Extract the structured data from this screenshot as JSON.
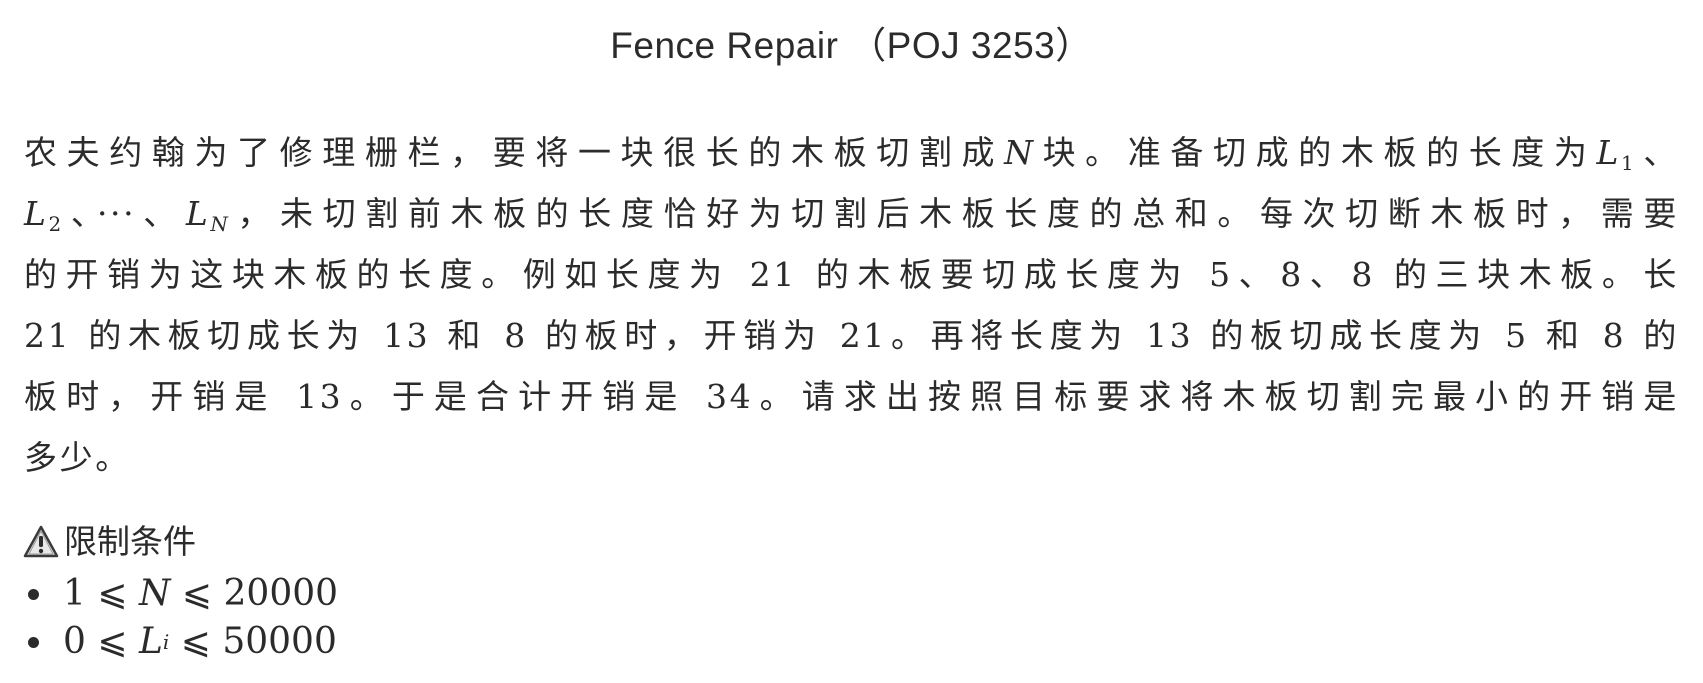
{
  "title": "Fence Repair （POJ 3253）",
  "paragraph": {
    "line1_a": "农夫约翰为了修理栅栏，要将一块很长的木板切割成",
    "line1_n": "N",
    "line1_b": "块。准备切成的木板的长度为",
    "line1_l": "L",
    "line1_l_sub": "1",
    "line1_end": "、",
    "line2_l2": "L",
    "line2_l2_sub": "2",
    "line2_mid": "、···、",
    "line2_ln": "L",
    "line2_ln_sub": "N",
    "line2_rest": "，未切割前木板的长度恰好为切割后木板长度的总和。每次切断木板时，需要",
    "line3": "的开销为这块木板的长度。例如长度为 21 的木板要切成长度为 5、8、8 的三块木板。长",
    "line4": "21 的木板切成长为 13 和 8 的板时，开销为 21。再将长度为 13 的板切成长度为 5 和 8 的",
    "line5": "板时，开销是 13。于是合计开销是 34。请求出按照目标要求将木板切割完最小的开销是",
    "line6": "多少。"
  },
  "constraints": {
    "heading": "限制条件",
    "items": [
      {
        "prefix": "1 ⩽ ",
        "var": "N",
        "sub": "",
        "suffix": " ⩽ 20000"
      },
      {
        "prefix": "0 ⩽ ",
        "var": "L",
        "sub": "i",
        "suffix": " ⩽ 50000"
      }
    ]
  }
}
